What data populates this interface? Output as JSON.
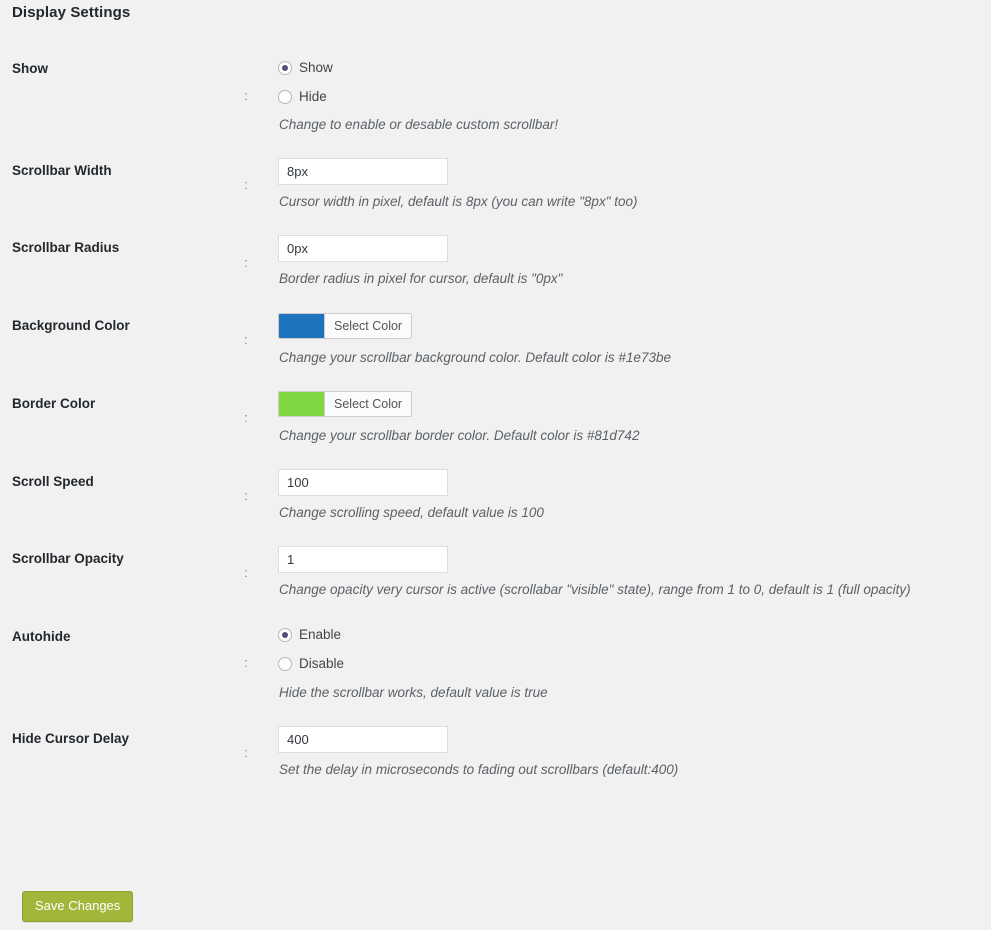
{
  "page": {
    "title": "Display Settings",
    "colon": ":"
  },
  "rows": [
    {
      "label": "Show",
      "type": "radio",
      "options": [
        {
          "label": "Show",
          "checked": true
        },
        {
          "label": "Hide",
          "checked": false
        }
      ],
      "description": "Change to enable or desable custom scrollbar!"
    },
    {
      "label": "Scrollbar Width",
      "type": "text",
      "value": "8px",
      "description": "Cursor width in pixel, default is 8px (you can write \"8px\" too)"
    },
    {
      "label": "Scrollbar Radius",
      "type": "text",
      "value": "0px",
      "description": "Border radius in pixel for cursor, default is \"0px\""
    },
    {
      "label": "Background Color",
      "type": "color",
      "button_label": "Select Color",
      "color": "#1e73be",
      "description": "Change your scrollbar background color. Default color is #1e73be"
    },
    {
      "label": "Border Color",
      "type": "color",
      "button_label": "Select Color",
      "color": "#81d742",
      "description": "Change your scrollbar border color. Default color is #81d742"
    },
    {
      "label": "Scroll Speed",
      "type": "text",
      "value": "100",
      "description": "Change scrolling speed, default value is 100"
    },
    {
      "label": "Scrollbar Opacity",
      "type": "text",
      "value": "1",
      "description": "Change opacity very cursor is active (scrollabar \"visible\" state), range from 1 to 0, default is 1 (full opacity)"
    },
    {
      "label": "Autohide",
      "type": "radio",
      "options": [
        {
          "label": "Enable",
          "checked": true
        },
        {
          "label": "Disable",
          "checked": false
        }
      ],
      "description": "Hide the scrollbar works, default value is true"
    },
    {
      "label": "Hide Cursor Delay",
      "type": "text",
      "value": "400",
      "description": "Set the delay in microseconds to fading out scrollbars (default:400)"
    }
  ],
  "submit": {
    "save_label": "Save Changes"
  }
}
